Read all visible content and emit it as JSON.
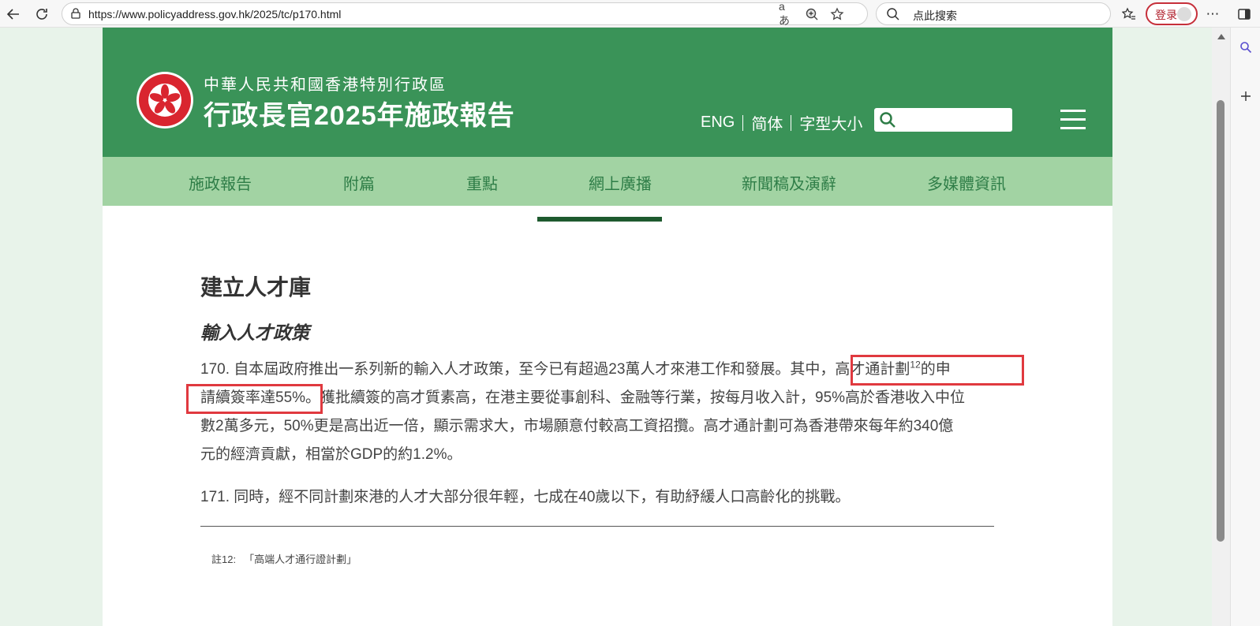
{
  "browser": {
    "url": "https://www.policyaddress.gov.hk/2025/tc/p170.html",
    "search_placeholder": "点此搜索",
    "login_label": "登录"
  },
  "header": {
    "subtitle": "中華人民共和國香港特別行政區",
    "title": "行政長官2025年施政報告",
    "links": [
      "ENG",
      "简体",
      "字型大小"
    ]
  },
  "nav": {
    "items": [
      "施政報告",
      "附篇",
      "重點",
      "網上廣播",
      "新聞稿及演辭",
      "多媒體資訊"
    ]
  },
  "content": {
    "section_title": "建立人才庫",
    "subsection_title": "輸入人才政策",
    "para170": {
      "part1": "170. 自本屆政府推出一系列新的輸入人才政策，至今已有超過23萬人才來港工作和發展。其中，",
      "highlight1": "高才通計劃",
      "sup": "12",
      "highlight2": "的申",
      "line2_highlight": "請續簽率達55%。",
      "rest": "獲批續簽的高才質素高，在港主要從事創科、金融等行業，按每月收入計，95%高於香港收入中位",
      "line3": "數2萬多元，50%更是高出近一倍，顯示需求大，市場願意付較高工資招攬。高才通計劃可為香港帶來每年約340億",
      "line4": "元的經濟貢獻，相當於GDP的約1.2%。"
    },
    "para171": "171. 同時，經不同計劃來港的人才大部分很年輕，七成在40歲以下，有助紓緩人口高齡化的挑戰。",
    "footnote_label": "註12:",
    "footnote_text": "「高端人才通行證計劃」"
  },
  "colors": {
    "header_green": "#3a9358",
    "nav_green": "#a2d3a3",
    "highlight_red": "#e0393f"
  }
}
